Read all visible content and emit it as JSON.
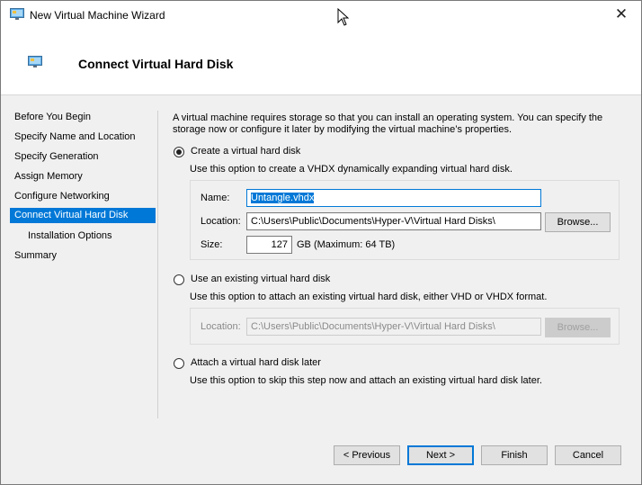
{
  "window": {
    "title": "New Virtual Machine Wizard",
    "icon": "vm-monitor-icon",
    "close_glyph": "✕"
  },
  "header": {
    "title": "Connect Virtual Hard Disk",
    "icon": "vm-monitor-icon"
  },
  "sidebar": {
    "items": [
      {
        "label": "Before You Begin"
      },
      {
        "label": "Specify Name and Location"
      },
      {
        "label": "Specify Generation"
      },
      {
        "label": "Assign Memory"
      },
      {
        "label": "Configure Networking"
      },
      {
        "label": "Connect Virtual Hard Disk",
        "selected": true
      },
      {
        "label": "Installation Options",
        "sub": true
      },
      {
        "label": "Summary"
      }
    ]
  },
  "main": {
    "description": "A virtual machine requires storage so that you can install an operating system. You can specify the storage now or configure it later by modifying the virtual machine’s properties.",
    "option_create": {
      "label": "Create a virtual hard disk",
      "help": "Use this option to create a VHDX dynamically expanding virtual hard disk.",
      "name_label": "Name:",
      "name_value": "Untangle.vhdx",
      "location_label": "Location:",
      "location_value": "C:\\Users\\Public\\Documents\\Hyper-V\\Virtual Hard Disks\\",
      "browse_label": "Browse...",
      "size_label": "Size:",
      "size_value": "127",
      "size_unit": "GB (Maximum: 64 TB)",
      "selected": true
    },
    "option_existing": {
      "label": "Use an existing virtual hard disk",
      "help": "Use this option to attach an existing virtual hard disk, either VHD or VHDX format.",
      "location_label": "Location:",
      "location_value": "C:\\Users\\Public\\Documents\\Hyper-V\\Virtual Hard Disks\\",
      "browse_label": "Browse..."
    },
    "option_later": {
      "label": "Attach a virtual hard disk later",
      "help": "Use this option to skip this step now and attach an existing virtual hard disk later."
    }
  },
  "footer": {
    "previous_label": "< Previous",
    "next_label": "Next >",
    "finish_label": "Finish",
    "cancel_label": "Cancel"
  }
}
